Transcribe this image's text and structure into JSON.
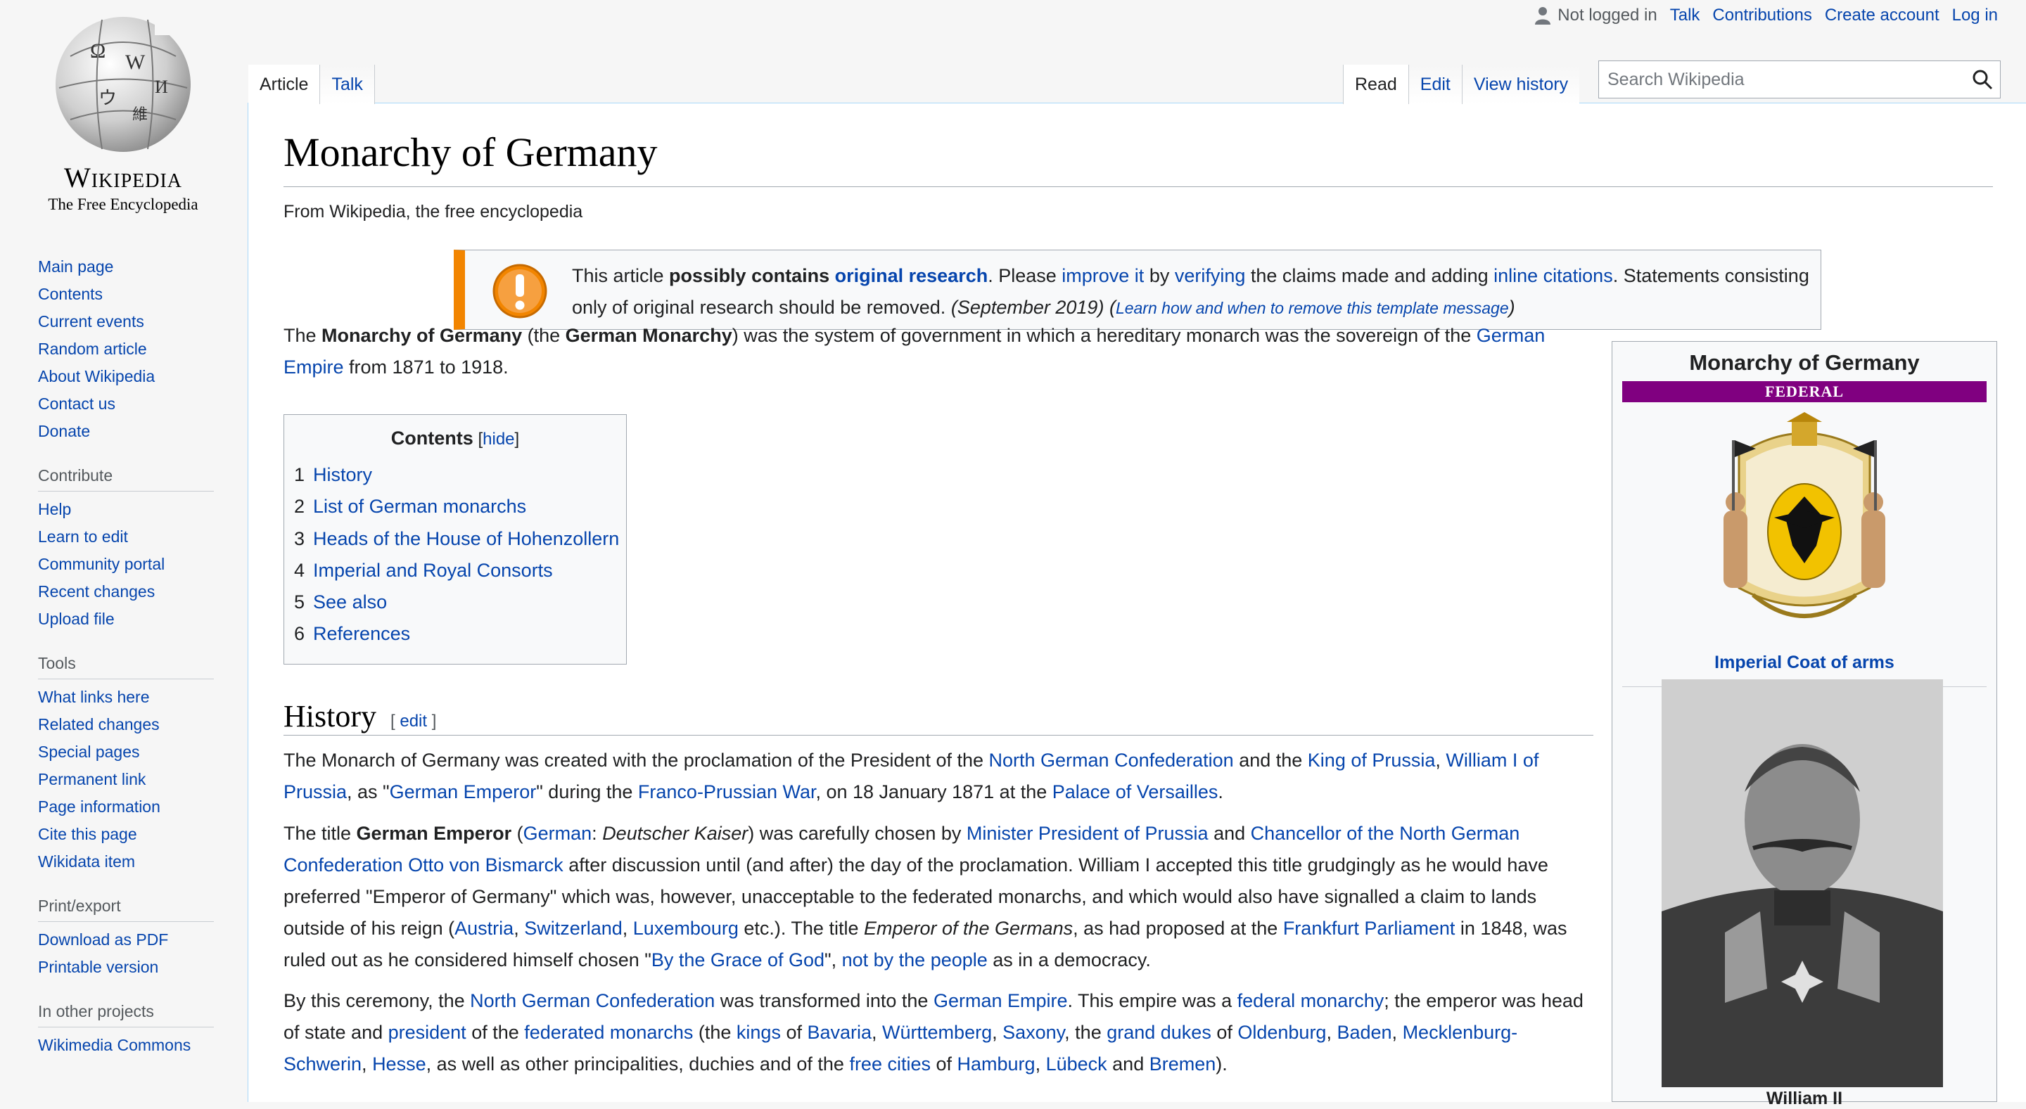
{
  "personal": {
    "not_logged_in": "Not logged in",
    "talk": "Talk",
    "contributions": "Contributions",
    "create_account": "Create account",
    "log_in": "Log in"
  },
  "logo": {
    "wordmark": "Wikipedia",
    "tagline": "The Free Encyclopedia"
  },
  "sidebar": {
    "main": [
      "Main page",
      "Contents",
      "Current events",
      "Random article",
      "About Wikipedia",
      "Contact us",
      "Donate"
    ],
    "contribute": {
      "heading": "Contribute",
      "items": [
        "Help",
        "Learn to edit",
        "Community portal",
        "Recent changes",
        "Upload file"
      ]
    },
    "tools": {
      "heading": "Tools",
      "items": [
        "What links here",
        "Related changes",
        "Special pages",
        "Permanent link",
        "Page information",
        "Cite this page",
        "Wikidata item"
      ]
    },
    "print": {
      "heading": "Print/export",
      "items": [
        "Download as PDF",
        "Printable version"
      ]
    },
    "projects": {
      "heading": "In other projects",
      "items": [
        "Wikimedia Commons"
      ]
    }
  },
  "tabs": {
    "article": "Article",
    "talk": "Talk",
    "read": "Read",
    "edit": "Edit",
    "view_history": "View history"
  },
  "search": {
    "placeholder": "Search Wikipedia"
  },
  "page": {
    "title": "Monarchy of Germany",
    "tagline": "From Wikipedia, the free encyclopedia"
  },
  "ambox": {
    "t1": "This article ",
    "t2": "possibly contains ",
    "t3": "original research",
    "t4": ". Please ",
    "t5": "improve it",
    "t6": " by ",
    "t7": "verifying",
    "t8": " the claims made and adding ",
    "t9": "inline citations",
    "t10": ". Statements consisting only of original research should be removed. ",
    "date": "(September 2019)",
    "open": " (",
    "learn": "Learn how and when to remove this template message",
    "close": ")"
  },
  "intro": {
    "a": "The ",
    "b": "Monarchy of Germany",
    "c": " (the ",
    "d": "German Monarchy",
    "e": ") was the system of government in which a hereditary monarch was the sovereign of the ",
    "f": "German Empire",
    "g": " from 1871 to 1918."
  },
  "toc": {
    "title": "Contents",
    "hide_open": " [",
    "hide": "hide",
    "hide_close": "]",
    "items": [
      {
        "num": "1",
        "label": "History"
      },
      {
        "num": "2",
        "label": "List of German monarchs"
      },
      {
        "num": "3",
        "label": "Heads of the House of Hohenzollern"
      },
      {
        "num": "4",
        "label": "Imperial and Royal Consorts"
      },
      {
        "num": "5",
        "label": "See also"
      },
      {
        "num": "6",
        "label": "References"
      }
    ]
  },
  "history": {
    "heading": "History",
    "edit_open": "[ ",
    "edit": "edit",
    "edit_close": " ]"
  },
  "p1": {
    "a": "The Monarch of Germany was created with the proclamation of the President of the ",
    "b": "North German Confederation",
    "c": " and the ",
    "d": "King of Prussia",
    "e": ", ",
    "f": "William I of Prussia",
    "g": ", as \"",
    "h": "German Emperor",
    "i": "\" during the ",
    "j": "Franco-Prussian War",
    "k": ", on 18 January 1871 at the ",
    "l": "Palace of Versailles",
    "m": "."
  },
  "p2": {
    "a": "The title ",
    "b": "German Emperor",
    "c": " (",
    "d": "German",
    "e": ": ",
    "f": "Deutscher Kaiser",
    "g": ") was carefully chosen by ",
    "h": "Minister President of Prussia",
    "i": " and ",
    "j": "Chancellor of the North German Confederation Otto von Bismarck",
    "k": " after discussion until (and after) the day of the proclamation. William I accepted this title grudgingly as he would have preferred \"Emperor of Germany\" which was, however, unacceptable to the federated monarchs, and which would also have signalled a claim to lands outside of his reign (",
    "l": "Austria",
    "m": ", ",
    "n": "Switzerland",
    "o": ", ",
    "p": "Luxembourg",
    "q": " etc.). The title ",
    "r": "Emperor of the Germans",
    "s": ", as had proposed at the ",
    "t": "Frankfurt Parliament",
    "u": " in 1848, was ruled out as he considered himself chosen \"",
    "v": "By the Grace of God",
    "w": "\", ",
    "x": "not by the people",
    "y": " as in a democracy."
  },
  "p3": {
    "a": "By this ceremony, the ",
    "b": "North German Confederation",
    "c": " was transformed into the ",
    "d": "German Empire",
    "e": ". This empire was a ",
    "f": "federal monarchy",
    "g": "; the emperor was head of state and ",
    "h": "president",
    "i": " of the ",
    "j": "federated monarchs",
    "k": " (the ",
    "l": "kings",
    "m": " of ",
    "n": "Bavaria",
    "o": ", ",
    "p": "Württemberg",
    "q": ", ",
    "r": "Saxony",
    "s": ", the ",
    "t": "grand dukes",
    "u": " of ",
    "v": "Oldenburg",
    "w": ", ",
    "x": "Baden",
    "y": ", ",
    "z": "Mecklenburg-Schwerin",
    "aa": ", ",
    "ab": "Hesse",
    "ac": ", as well as other principalities, duchies and of the ",
    "ad": "free cities",
    "ae": " of ",
    "af": "Hamburg",
    "ag": ", ",
    "ah": "Lübeck",
    "ai": " and ",
    "aj": "Bremen",
    "ak": ")."
  },
  "infobox": {
    "title": "Monarchy of Germany",
    "bar": "FEDERAL",
    "coat_caption": "Imperial Coat of arms",
    "photo_caption": "William II"
  },
  "colors": {
    "link": "#0645ad",
    "ambox_accent": "#f28500",
    "infobox_bar": "#800080"
  }
}
